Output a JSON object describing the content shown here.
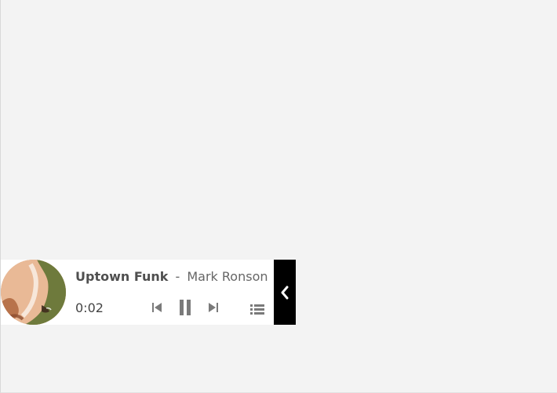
{
  "player": {
    "song_title": "Uptown Funk",
    "separator": "-",
    "artist": "Mark Ronson",
    "current_time": "0:02"
  },
  "icons": {
    "prev": "skip-previous-icon",
    "pause": "pause-icon",
    "next": "skip-next-icon",
    "playlist": "playlist-icon",
    "collapse": "chevron-left-icon"
  },
  "colors": {
    "background": "#f3f3f3",
    "player_bg": "#ffffff",
    "icon_gray": "#7a7a7a",
    "tab_bg": "#000000"
  }
}
